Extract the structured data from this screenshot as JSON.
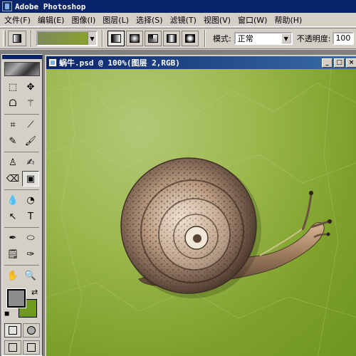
{
  "app": {
    "title": "Adobe Photoshop"
  },
  "menu": {
    "items": [
      "文件(F)",
      "编辑(E)",
      "图像(I)",
      "图层(L)",
      "选择(S)",
      "滤镜(T)",
      "视图(V)",
      "窗口(W)",
      "帮助(H)"
    ]
  },
  "options": {
    "mode_label": "模式:",
    "mode_value": "正常",
    "opacity_label": "不透明度:",
    "opacity_value": "100",
    "gradient_colors": [
      "#7c8a5c",
      "#8aa02e"
    ],
    "gradient_types": [
      "linear",
      "radial",
      "angle",
      "reflected",
      "diamond"
    ],
    "selected_gradient_type": "linear"
  },
  "toolbox": {
    "tools": [
      {
        "name": "marquee-tool",
        "glyph": "⬚"
      },
      {
        "name": "move-tool",
        "glyph": "✥"
      },
      {
        "name": "lasso-tool",
        "glyph": "ᗝ"
      },
      {
        "name": "magic-wand-tool",
        "glyph": "⚚"
      },
      {
        "name": "crop-tool",
        "glyph": "⌗"
      },
      {
        "name": "slice-tool",
        "glyph": "⟋"
      },
      {
        "name": "healing-brush-tool",
        "glyph": "✎"
      },
      {
        "name": "brush-tool",
        "glyph": "🖌"
      },
      {
        "name": "clone-stamp-tool",
        "glyph": "♙"
      },
      {
        "name": "history-brush-tool",
        "glyph": "✍"
      },
      {
        "name": "eraser-tool",
        "glyph": "⌫"
      },
      {
        "name": "gradient-tool",
        "glyph": "▣"
      },
      {
        "name": "blur-tool",
        "glyph": "💧"
      },
      {
        "name": "dodge-tool",
        "glyph": "◔"
      },
      {
        "name": "path-selection-tool",
        "glyph": "↖"
      },
      {
        "name": "type-tool",
        "glyph": "T"
      },
      {
        "name": "pen-tool",
        "glyph": "✒"
      },
      {
        "name": "shape-tool",
        "glyph": "⬭"
      },
      {
        "name": "notes-tool",
        "glyph": "🗒"
      },
      {
        "name": "eyedropper-tool",
        "glyph": "✑"
      },
      {
        "name": "hand-tool",
        "glyph": "✋"
      },
      {
        "name": "zoom-tool",
        "glyph": "🔍"
      }
    ],
    "selected_tool": "gradient-tool",
    "foreground_color": "#8c8c8c",
    "background_color": "#6e9a1e"
  },
  "document": {
    "title": "蜗牛.psd @ 100%(图层 2,RGB)",
    "window_buttons": [
      "_",
      "□",
      "×"
    ],
    "canvas_colors": [
      "#b3c878",
      "#9db94f",
      "#7da02a"
    ]
  }
}
